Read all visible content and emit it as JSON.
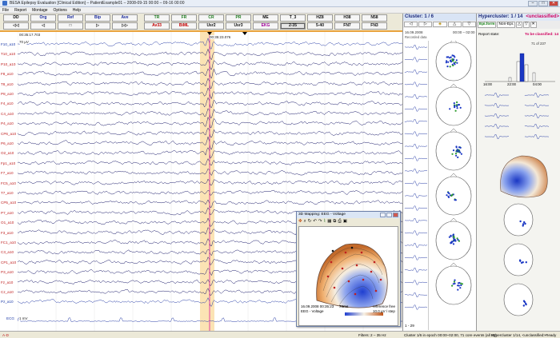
{
  "window": {
    "title": "BESA Epilepsy Evaluation [Clinical Edition] – PatientExample01 – 2008-09-15 00:00 – 09-16 00:00",
    "buttons": [
      "–",
      "□",
      "✕"
    ]
  },
  "menu": [
    "File",
    "Report",
    "Montage",
    "Options",
    "Help"
  ],
  "toolbar": {
    "row1": [
      {
        "label": "DD",
        "color": "black"
      },
      {
        "label": "Org",
        "color": "blue"
      },
      {
        "label": "Ref",
        "color": "blue"
      },
      {
        "label": "Bip",
        "color": "blue"
      },
      {
        "label": "Ave",
        "color": "blue"
      },
      {
        "label": "TR",
        "color": "green"
      },
      {
        "label": "FR",
        "color": "green"
      },
      {
        "label": "CR",
        "color": "green"
      },
      {
        "label": "PR",
        "color": "green"
      },
      {
        "label": "ME",
        "color": "black"
      },
      {
        "label": "T_3",
        "color": "black"
      },
      {
        "label": "HZ8",
        "color": "black"
      },
      {
        "label": "H38",
        "color": "black"
      },
      {
        "label": "N58",
        "color": "black"
      }
    ],
    "row2": [
      {
        "label": "◁◁",
        "color": "black"
      },
      {
        "label": "◁",
        "color": "black"
      },
      {
        "label": "□",
        "color": "black"
      },
      {
        "label": "▷",
        "color": "black"
      },
      {
        "label": "▷▷",
        "color": "black"
      },
      {
        "label": " Av33",
        "color": "red"
      },
      {
        "label": "BiML",
        "color": "red"
      },
      {
        "label": "Usr2",
        "color": "black"
      },
      {
        "label": "Usr3",
        "color": "black"
      },
      {
        "label": "EKG",
        "color": "magenta"
      },
      {
        "label": "2-35",
        "color": "black"
      },
      {
        "label": "5-40",
        "color": "black"
      },
      {
        "label": "FN7",
        "color": "black"
      },
      {
        "label": "FN3",
        "color": "black"
      }
    ]
  },
  "eeg": {
    "start_time": "00:35:17.703",
    "cursor_time": "00:35:23.076",
    "scale": "70 µV",
    "ecg_label": "ECG",
    "ecg_scale": "1 mV",
    "channels": [
      "F10_a10",
      "T10_a10",
      "P10_a10",
      "F8_a10",
      "T8_a10",
      "P8_a10",
      "F4_a10",
      "C4_a10",
      "P4_a10",
      "CP6_a10",
      "P6_a10",
      "O2_a10",
      "Fp1_a10",
      "F7_a10",
      "FC5_a10",
      "T7_a10",
      "CP5_a10",
      "P7_a10",
      "O1_a10",
      "F3_a10",
      "FC1_a10",
      "C3_a10",
      "CP1_a10",
      "P3_a10",
      "Fz_a10",
      "Cz_a10",
      "Pz_a10"
    ],
    "blue_channel_indices": [
      0,
      26
    ]
  },
  "statusbar": {
    "left": "A-D",
    "filters": "Filters: 2 – 35 Hz",
    "cluster": "Cluster 1/6 in epoch 00:00–02:00, 71 core events (all 82)",
    "hyper": "Hypercluster 1/14, <unclassified>",
    "ready": "Ready"
  },
  "cluster_panel": {
    "title": "Cluster: 1 / 6",
    "tools": [
      "◁",
      "▷",
      "◈",
      "△",
      "▽"
    ],
    "date": "16.09.2008",
    "range": "00:00 – 02:00",
    "subtitle": "Recorded data",
    "pager": "1 - 29"
  },
  "hyper_panel": {
    "title": "Hypercluster: 1 / 14",
    "unclassified": "<unclassified>",
    "tools": [
      "Epi.form",
      "Non-Epi.",
      "△",
      "▽",
      "✕"
    ],
    "report_state_label": "Report state:",
    "to_be_classified": "To be classified: 14",
    "count_label": "71 of 237",
    "axis_ticks": [
      "16:00",
      "22:00",
      "04:00"
    ]
  },
  "map_window": {
    "title": "3D Mapping: EEG - Voltage",
    "timestamp": "16.09.2008 00:35:23",
    "duration": "70ms",
    "mode": "EEG - Voltage",
    "reference": "reference free",
    "scale": "10.0 µV / step"
  },
  "colors": {
    "cursor": "#e0309a",
    "highlight": "#fbe3b4",
    "channel_red": "#c02020",
    "channel_blue": "#1b3aa8",
    "accent": "#e9a33e"
  }
}
